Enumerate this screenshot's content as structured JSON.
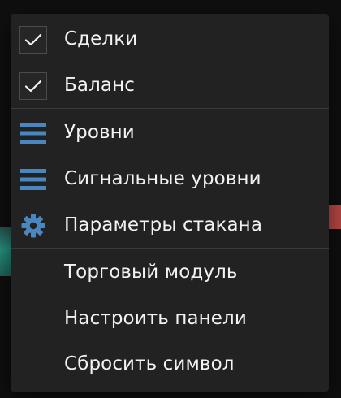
{
  "colors": {
    "menu_bg": "#222222",
    "text": "#f2f2f2",
    "icon_accent": "#4a86bf",
    "divider": "#3a3a3a"
  },
  "menu": {
    "items": [
      {
        "label": "Сделки",
        "icon": "checkmark-icon",
        "checked": true
      },
      {
        "label": "Баланс",
        "icon": "checkmark-icon",
        "checked": true
      },
      {
        "label": "Уровни",
        "icon": "hamburger-icon"
      },
      {
        "label": "Сигнальные уровни",
        "icon": "hamburger-icon"
      },
      {
        "label": "Параметры стакана",
        "icon": "gear-icon"
      },
      {
        "label": "Торговый модуль",
        "icon": ""
      },
      {
        "label": "Настроить панели",
        "icon": ""
      },
      {
        "label": "Сбросить символ",
        "icon": ""
      }
    ]
  }
}
